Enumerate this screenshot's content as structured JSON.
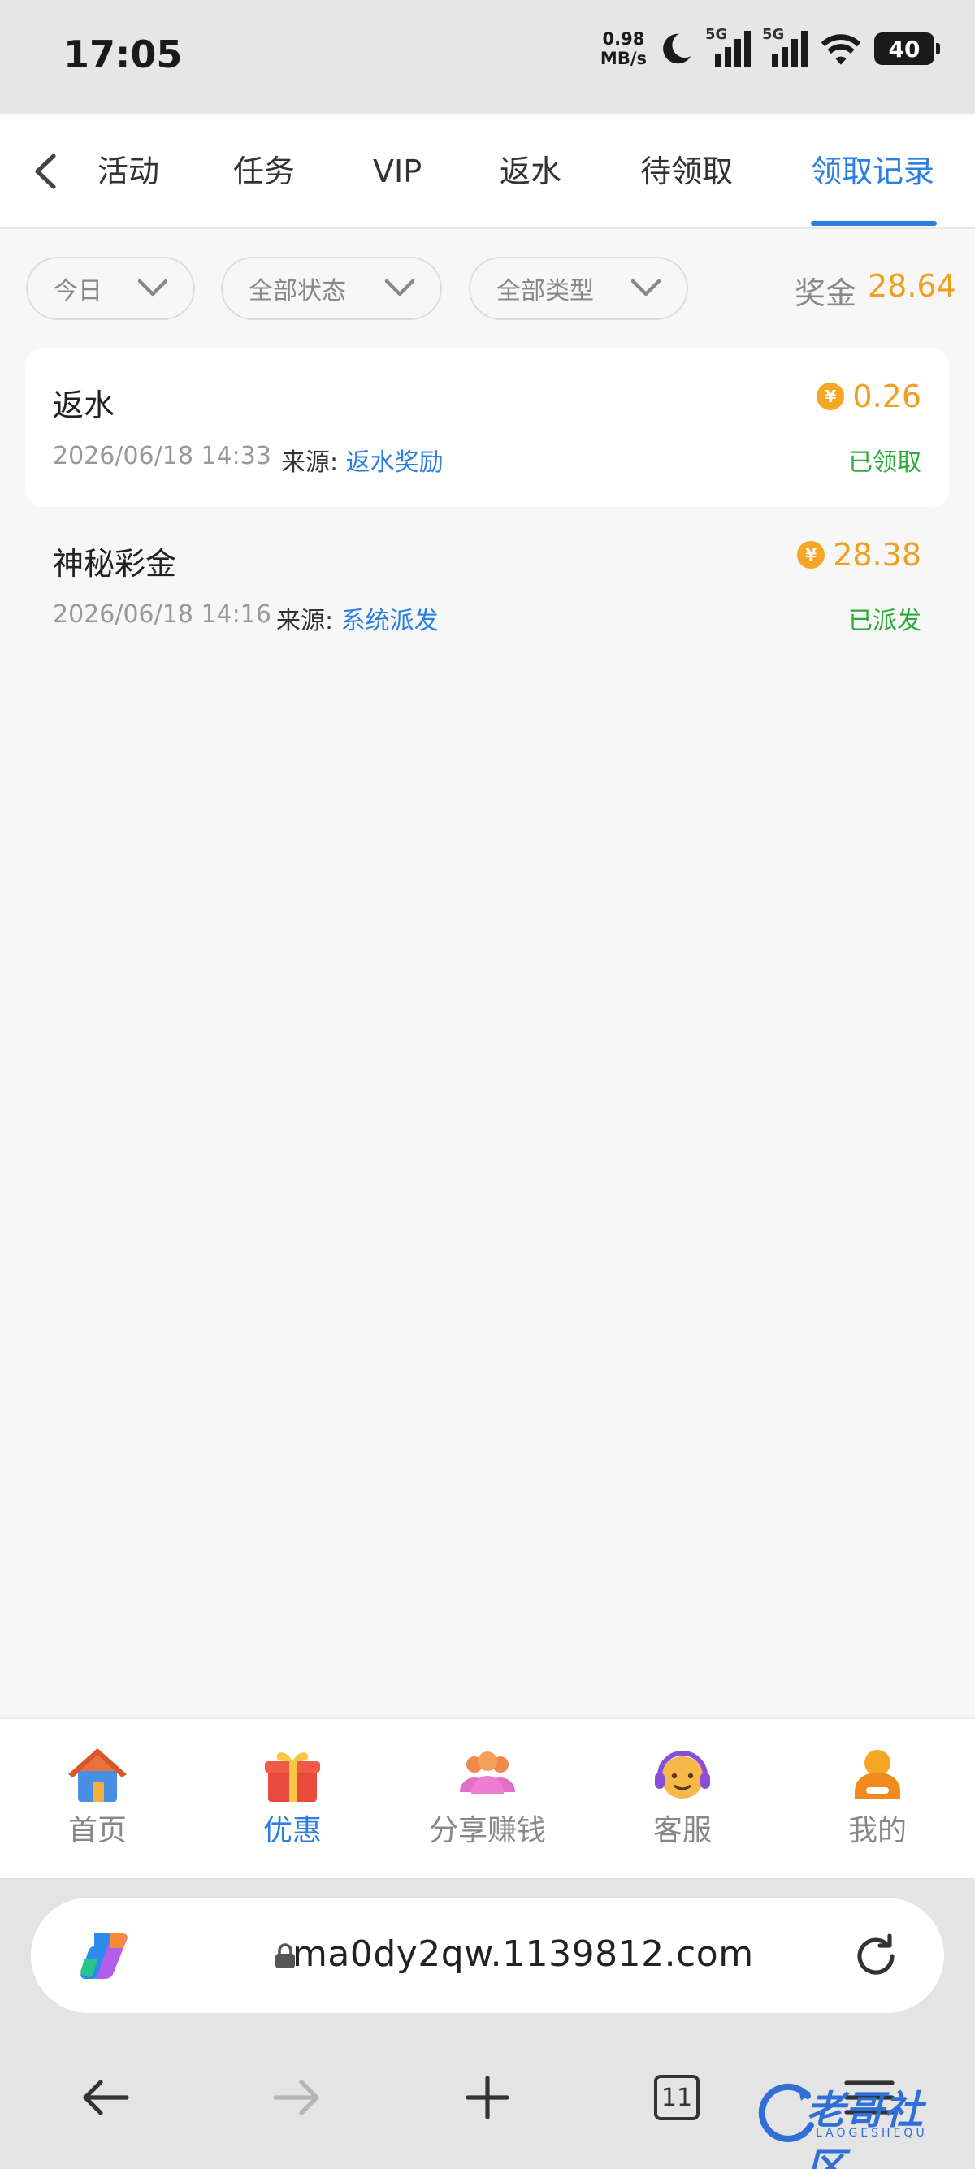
{
  "status_bar": {
    "time": "17:05",
    "net_speed_value": "0.98",
    "net_speed_unit": "MB/s",
    "sim1": "5G",
    "sim2": "5G",
    "battery": "40"
  },
  "tabs": [
    {
      "label": "活动",
      "active": false
    },
    {
      "label": "任务",
      "active": false
    },
    {
      "label": "VIP",
      "active": false
    },
    {
      "label": "返水",
      "active": false
    },
    {
      "label": "待领取",
      "active": false
    },
    {
      "label": "领取记录",
      "active": true
    }
  ],
  "filters": {
    "date": "今日",
    "status": "全部状态",
    "type": "全部类型"
  },
  "bonus": {
    "label": "奖金",
    "value": "28.64"
  },
  "records": [
    {
      "title": "返水",
      "datetime": "2026/06/18 14:33",
      "source_label": "来源:",
      "source": "返水奖励",
      "amount": "0.26",
      "status": "已领取"
    },
    {
      "title": "神秘彩金",
      "datetime": "2026/06/18 14:16",
      "source_label": "来源:",
      "source": "系统派发",
      "amount": "28.38",
      "status": "已派发"
    }
  ],
  "coin_symbol": "¥",
  "bottom_nav": [
    {
      "label": "首页",
      "icon": "house-icon",
      "active": false
    },
    {
      "label": "优惠",
      "icon": "gift-icon",
      "active": true
    },
    {
      "label": "分享赚钱",
      "icon": "people-icon",
      "active": false
    },
    {
      "label": "客服",
      "icon": "headset-icon",
      "active": false
    },
    {
      "label": "我的",
      "icon": "user-icon",
      "active": false
    }
  ],
  "browser": {
    "url": "ma0dy2qw.1139812.com",
    "tab_count": "11"
  },
  "watermark": {
    "text": "老哥社区",
    "sub": "LAOGESHEQU"
  },
  "colors": {
    "accent": "#2b7fe0",
    "gold": "#f0a020",
    "success": "#2eaa3a"
  }
}
